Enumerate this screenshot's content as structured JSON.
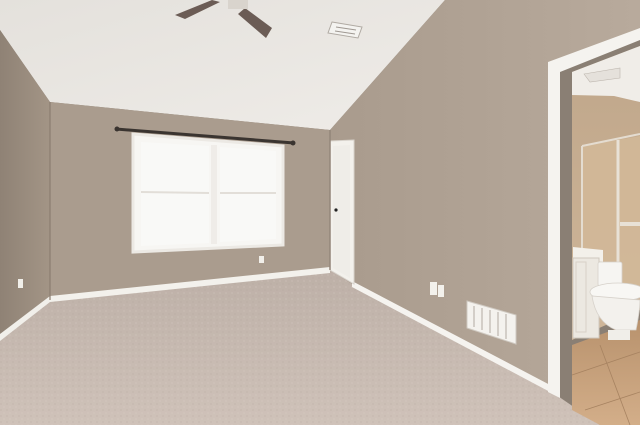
{
  "scene": {
    "kind": "photo",
    "subject": "empty-bedroom-interior",
    "colors": {
      "ceiling": "#ebe8e3",
      "wall_back": "#aa9c8e",
      "wall_left": "#9d8f81",
      "wall_right": "#b3a597",
      "carpet": "#c8bbb3",
      "trim": "#f5f3ef",
      "window_glass": "#f7f7f5",
      "bath_floor": "#c9a27e",
      "bath_wall": "#c5ad91"
    },
    "fixtures": [
      "ceiling-fan",
      "ceiling-vent",
      "curtain-rod",
      "double-window",
      "closet-door",
      "bathroom-doorway",
      "toilet",
      "vanity-cabinet",
      "shower-enclosure",
      "floor-register",
      "wall-outlets"
    ]
  }
}
